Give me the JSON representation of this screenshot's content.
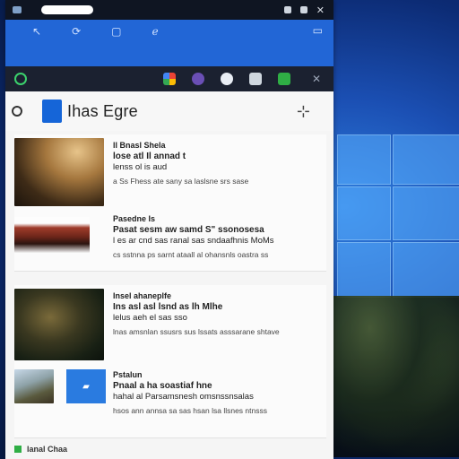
{
  "app": {
    "title": "Ihas Egre"
  },
  "ribbon": {
    "right_icon": "folder-icon"
  },
  "toolbar": {
    "close_label": "✕"
  },
  "appbar": {
    "pin_icon": "pin-icon"
  },
  "feed": {
    "cards": [
      {
        "kicker": "ll Bnasl Shela",
        "headline": "lose atl Il annad t",
        "body": "lenss ol is aud",
        "meta": "a Ss Fhess ate sany sa laslsne srs sase"
      },
      {
        "kicker": "Pasedne Is",
        "headline": "Pasat sesm aw samd S\" ssonosesa",
        "body": "l es ar cnd sas ranal sas sndaafhnis MoMs",
        "meta": "cs sstnna ps sarnt ataall al ohansnls oastra ss"
      },
      {
        "kicker": "Insel ahaneplfe",
        "headline": "Ins asl asl lsnd as lh Mlhe",
        "body": "lelus aeh el sas sso",
        "meta": "lnas amsnlan ssusrs sus lssats asssarane shtave"
      },
      {
        "kicker": "Pstalun",
        "headline": "Pnaal a ha soastiaf  hne",
        "body": "hahal al Parsamsnesh omsnssnsalas",
        "meta": "hsos ann annsa sa sas hsan lsa llsnes ntnsss"
      }
    ],
    "bottom_label": "lanal Chaa"
  },
  "colors": {
    "ribbon": "#2266d6",
    "accent": "#1565d8",
    "desktop": "#1b4fb3"
  }
}
